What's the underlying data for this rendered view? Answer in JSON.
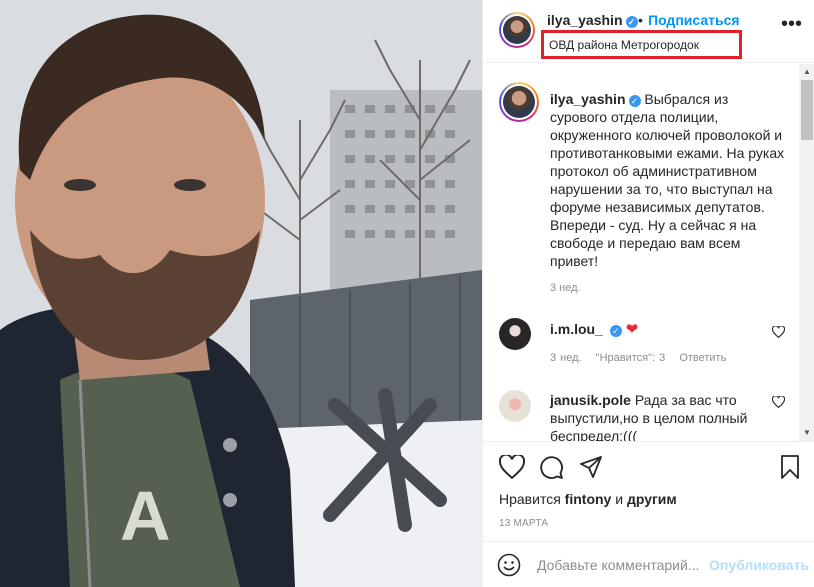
{
  "post": {
    "username": "ilya_yashin",
    "follow_label": "Подписаться",
    "separator": "•",
    "location": "ОВД района Метрогородок",
    "caption_user": "ilya_yashin",
    "caption_text": "Выбрался из сурового отдела полиции, окруженного колючей проволокой и противотанковыми ежами. На руках протокол об административном нарушении за то, что выступал на форуме независимых депутатов. Впереди - суд. Ну а сейчас я на свободе и передаю вам всем привет!",
    "caption_time": "3 нед."
  },
  "comments": [
    {
      "user": "i.m.lou_",
      "text": "",
      "meta_time": "3 нед.",
      "meta_likes": "\"Нравится\": 3",
      "meta_reply": "Ответить"
    },
    {
      "user": "janusik.pole",
      "text": "Рада за вас что выпустили,но в целом полный беспредел:((("
    }
  ],
  "actions": {
    "likes_prefix": "Нравится",
    "likes_user": "fintony",
    "likes_suffix": "и",
    "likes_others": "другим",
    "date": "13 МАРТА"
  },
  "composer": {
    "placeholder": "Добавьте комментарий...",
    "publish_label": "Опубликовать"
  },
  "icons": [
    "verified-icon",
    "more-icon",
    "heart-icon",
    "comment-icon",
    "share-icon",
    "bookmark-icon",
    "emoji-icon"
  ],
  "colors": {
    "accent": "#0095f6",
    "highlight_box": "#e0202a",
    "heart": "#ed2936",
    "meta": "#8e8e8e"
  }
}
